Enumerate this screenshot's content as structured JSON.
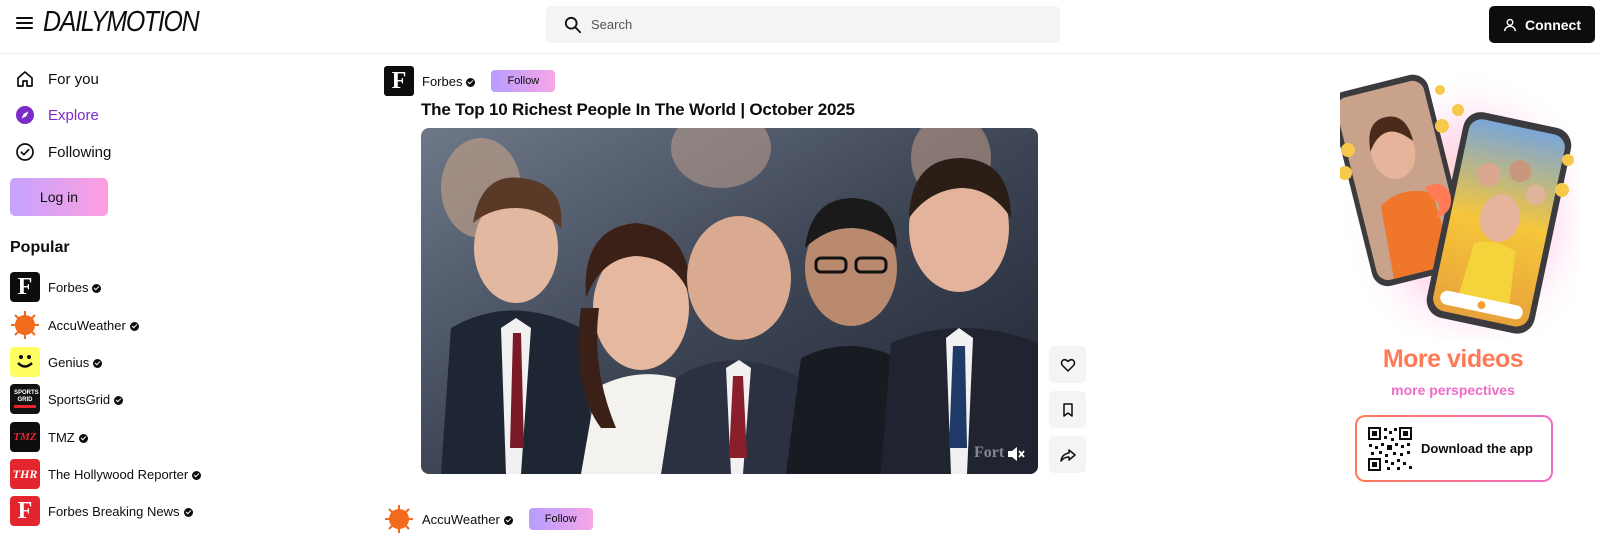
{
  "header": {
    "logo": "DAILYMOTION",
    "search_placeholder": "Search",
    "connect_label": "Connect"
  },
  "sidebar": {
    "nav": [
      {
        "label": "For you",
        "icon": "home-icon"
      },
      {
        "label": "Explore",
        "icon": "compass-icon",
        "active": true
      },
      {
        "label": "Following",
        "icon": "check-circle-icon"
      }
    ],
    "login_label": "Log in",
    "popular_title": "Popular",
    "channels": [
      {
        "name": "Forbes",
        "verified": true
      },
      {
        "name": "AccuWeather",
        "verified": true
      },
      {
        "name": "Genius",
        "verified": true
      },
      {
        "name": "SportsGrid",
        "verified": true
      },
      {
        "name": "TMZ",
        "verified": true
      },
      {
        "name": "The Hollywood Reporter",
        "verified": true
      },
      {
        "name": "Forbes Breaking News",
        "verified": true
      }
    ],
    "channel_logo_text": {
      "forbes": "F",
      "sportsgrid": "SPORTS GRID",
      "tmz": "TMZ",
      "thr": "THR"
    }
  },
  "feed": {
    "posts": [
      {
        "channel": "Forbes",
        "follow_label": "Follow",
        "title": "The Top 10 Richest People In The World | October 2025",
        "watermark": "Fort"
      },
      {
        "channel": "AccuWeather",
        "follow_label": "Follow"
      }
    ],
    "actions": [
      "heart-icon",
      "bookmark-icon",
      "share-icon"
    ]
  },
  "promo": {
    "title": "More videos",
    "subtitle": "more perspectives",
    "download_label": "Download the app"
  },
  "colors": {
    "accent_purple": "#7b2bc8",
    "follow_gradient": [
      "#b79cff",
      "#f7a6e6"
    ],
    "promo_orange": "#ff7a55",
    "promo_pink": "#f06ac9"
  }
}
